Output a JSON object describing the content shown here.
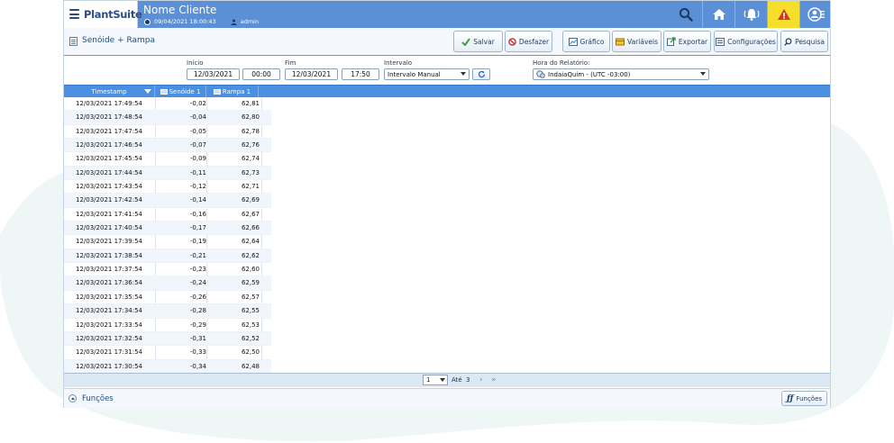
{
  "header": {
    "logo": "PlantSuite",
    "client_name": "Nome Cliente",
    "datetime": "09/04/2021 18:00:43",
    "user": "admin",
    "icons": [
      "search-icon",
      "home-icon",
      "alarm-bell-icon",
      "warning-icon",
      "user-menu-icon"
    ],
    "warning_color": "#f6df2b",
    "accent": "#5b8fd6"
  },
  "page": {
    "title": "Senóide + Rampa"
  },
  "toolbar": {
    "save": "Salvar",
    "undo": "Desfazer",
    "chart": "Gráfico",
    "variables": "Variáveis",
    "export": "Exportar",
    "settings": "Configurações",
    "search": "Pesquisa"
  },
  "filters": {
    "start_label": "Início",
    "start_date": "12/03/2021",
    "start_time": "00:00",
    "end_label": "Fim",
    "end_date": "12/03/2021",
    "end_time": "17:50",
    "interval_label": "Intervalo",
    "interval_value": "Intervalo Manual",
    "report_time_label": "Hora do Relatório:",
    "report_time_value": "IndaiaQuim - (UTC -03:00)"
  },
  "table": {
    "columns": [
      "Timestamp",
      "Senóide 1",
      "Rampa 1"
    ],
    "rows": [
      [
        "12/03/2021 17:49:54",
        "-0,02",
        "62,81"
      ],
      [
        "12/03/2021 17:48:54",
        "-0,04",
        "62,80"
      ],
      [
        "12/03/2021 17:47:54",
        "-0,05",
        "62,78"
      ],
      [
        "12/03/2021 17:46:54",
        "-0,07",
        "62,76"
      ],
      [
        "12/03/2021 17:45:54",
        "-0,09",
        "62,74"
      ],
      [
        "12/03/2021 17:44:54",
        "-0,11",
        "62,73"
      ],
      [
        "12/03/2021 17:43:54",
        "-0,12",
        "62,71"
      ],
      [
        "12/03/2021 17:42:54",
        "-0,14",
        "62,69"
      ],
      [
        "12/03/2021 17:41:54",
        "-0,16",
        "62,67"
      ],
      [
        "12/03/2021 17:40:54",
        "-0,17",
        "62,66"
      ],
      [
        "12/03/2021 17:39:54",
        "-0,19",
        "62,64"
      ],
      [
        "12/03/2021 17:38:54",
        "-0,21",
        "62,62"
      ],
      [
        "12/03/2021 17:37:54",
        "-0,23",
        "62,60"
      ],
      [
        "12/03/2021 17:36:54",
        "-0,24",
        "62,59"
      ],
      [
        "12/03/2021 17:35:54",
        "-0,26",
        "62,57"
      ],
      [
        "12/03/2021 17:34:54",
        "-0,28",
        "62,55"
      ],
      [
        "12/03/2021 17:33:54",
        "-0,29",
        "62,53"
      ],
      [
        "12/03/2021 17:32:54",
        "-0,31",
        "62,52"
      ],
      [
        "12/03/2021 17:31:54",
        "-0,33",
        "62,50"
      ],
      [
        "12/03/2021 17:30:54",
        "-0,34",
        "62,48"
      ]
    ]
  },
  "pager": {
    "page": "1",
    "to_label": "Até",
    "total": "3"
  },
  "bottom": {
    "label": "Funções",
    "button": "Funções"
  }
}
